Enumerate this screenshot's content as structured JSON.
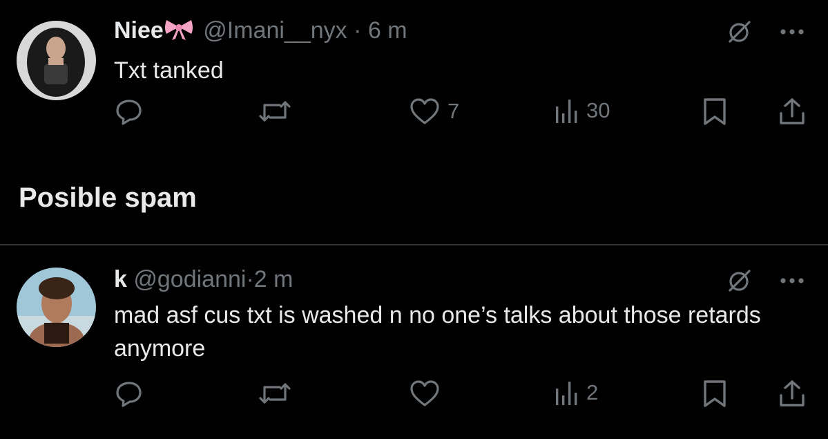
{
  "posts": [
    {
      "display_name": "Niee",
      "handle": "@Imani__nyx",
      "dot": "·",
      "time": "6 m",
      "text": "Txt tanked",
      "likes": "7",
      "views": "30",
      "icons": [
        "grok-icon",
        "more-icon",
        "reply-icon",
        "repost-icon",
        "like-icon",
        "views-icon",
        "bookmark-icon",
        "share-icon"
      ]
    },
    {
      "display_name": "k",
      "handle": "@godianni",
      "dot": "·",
      "time": "2 m",
      "text": "mad asf cus txt is washed n no one’s talks about those retards anymore",
      "likes": "",
      "views": "2",
      "icons": [
        "grok-icon",
        "more-icon",
        "reply-icon",
        "repost-icon",
        "like-icon",
        "views-icon",
        "bookmark-icon",
        "share-icon"
      ]
    }
  ],
  "section": {
    "title": "Posible spam"
  },
  "colors": {
    "background": "#000000",
    "text": "#e7e9ea",
    "muted": "#71767b",
    "divider": "#2f3336",
    "bow": "#f4a3c4"
  }
}
